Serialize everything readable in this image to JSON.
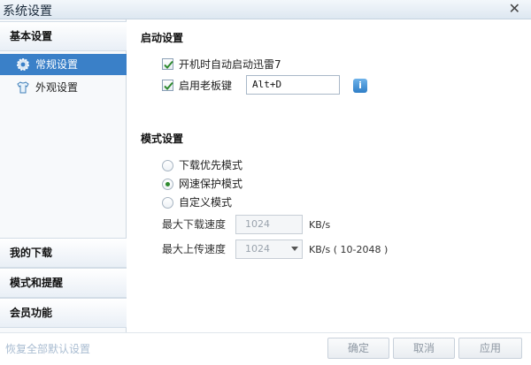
{
  "window": {
    "title": "系统设置"
  },
  "sidebar": {
    "basic": "基本设置",
    "general": "常规设置",
    "appearance": "外观设置",
    "downloads": "我的下载",
    "modes": "模式和提醒",
    "member": "会员功能"
  },
  "startup": {
    "title": "启动设置",
    "autostart_label": "开机时自动启动迅雷7",
    "autostart_checked": true,
    "bosskey_label": "启用老板键",
    "bosskey_checked": true,
    "bosskey_value": "Alt+D"
  },
  "mode": {
    "title": "模式设置",
    "options": [
      "下载优先模式",
      "网速保护模式",
      "自定义模式"
    ],
    "selected": "网速保护模式",
    "max_download_label": "最大下载速度",
    "max_download_value": "1024",
    "max_download_unit": "KB/s",
    "max_upload_label": "最大上传速度",
    "max_upload_value": "1024",
    "max_upload_unit": "KB/s ( 10-2048 )"
  },
  "footer": {
    "restore_defaults": "恢复全部默认设置",
    "ok": "确定",
    "cancel": "取消",
    "apply": "应用"
  },
  "icons": [
    "close-icon",
    "gear-icon",
    "shirt-icon",
    "checkmark-icon",
    "info-icon",
    "chevron-down-icon"
  ]
}
